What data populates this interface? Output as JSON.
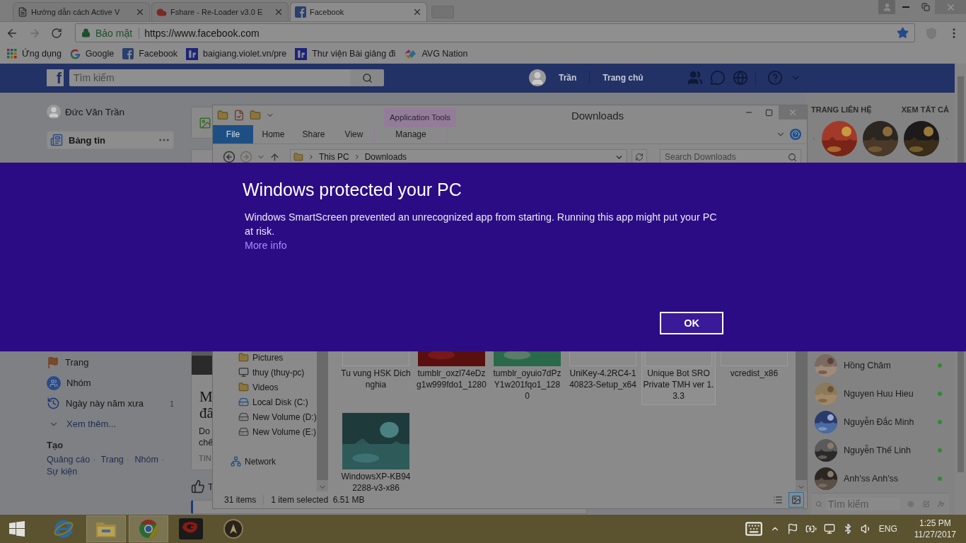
{
  "browser": {
    "tabs": [
      {
        "title": "Hướng dẫn cách Active V",
        "selected": false
      },
      {
        "title": "Fshare - Re-Loader v3.0 E",
        "selected": false
      },
      {
        "title": "Facebook",
        "selected": true
      }
    ],
    "address": {
      "security": "Bảo mật",
      "url": "https://www.facebook.com",
      "bookmarked": true
    },
    "bookmarks": [
      {
        "label": "Ứng dụng"
      },
      {
        "label": "Google"
      },
      {
        "label": "Facebook"
      },
      {
        "label": "baigiang.violet.vn/pre"
      },
      {
        "label": "Thư viện Bài giảng đi"
      },
      {
        "label": "AVG Nation"
      }
    ]
  },
  "facebook": {
    "logo": "f",
    "search": {
      "placeholder": "Tìm kiếm"
    },
    "user": "Trần",
    "home": "Trang chủ",
    "profile": "Đức Văn Trần",
    "menu": [
      {
        "label": "Bảng tin",
        "selected": true
      }
    ],
    "lower_menu": [
      {
        "label": "Trang",
        "kind": "item"
      },
      {
        "label": "Nhóm",
        "kind": "item"
      },
      {
        "label": "Ngày này năm xưa",
        "kind": "item",
        "count": "1"
      },
      {
        "label": "Xem thêm...",
        "kind": "more"
      }
    ],
    "create": {
      "title": "Tạo",
      "separator": "·",
      "links": [
        "Quảng cáo",
        "Trang",
        "Nhóm",
        "Sự kiện"
      ]
    },
    "post": {
      "title": [
        "M",
        "đâ"
      ],
      "text": [
        "Do",
        "chế"
      ],
      "tag": "TIN",
      "action": "T"
    },
    "pages": {
      "title": "TRANG LIÊN HỆ",
      "see_all": "XEM TẤT CẢ"
    },
    "contacts": [
      {
        "name": "Hồng Châm",
        "online": true
      },
      {
        "name": "Nguyen Huu Hieu",
        "online": true
      },
      {
        "name": "Nguyễn Đắc Minh",
        "online": true
      },
      {
        "name": "Nguyễn Thế Linh",
        "online": true
      },
      {
        "name": "Anh'ss Anh'ss",
        "online": true
      }
    ],
    "chat_search": {
      "placeholder": "Tìm kiếm"
    }
  },
  "explorer": {
    "title": "Downloads",
    "context_tab": "Application Tools",
    "ribbon_tabs": [
      {
        "label": "File",
        "selected": true
      },
      {
        "label": "Home",
        "selected": false
      },
      {
        "label": "Share",
        "selected": false
      },
      {
        "label": "View",
        "selected": false
      },
      {
        "label": "Manage",
        "selected": false
      }
    ],
    "path": [
      "This PC",
      "Downloads"
    ],
    "search": {
      "placeholder": "Search Downloads"
    },
    "nav": [
      {
        "label": "Pictures"
      },
      {
        "label": "thuy (thuy-pc)"
      },
      {
        "label": "Videos"
      },
      {
        "label": "Local Disk (C:)"
      },
      {
        "label": "New Volume (D:)"
      },
      {
        "label": "New Volume (E:)"
      },
      {
        "label": "Network"
      }
    ],
    "files": [
      {
        "name": "Tu vung HSK Dich nghia",
        "kind": "blank",
        "selected": false
      },
      {
        "name": "tumblr_oxzl74eDzg1w999fdo1_1280",
        "kind": "picture",
        "selected": false
      },
      {
        "name": "tumblr_oyuio7dPzY1w201fqo1_1280",
        "kind": "picture",
        "selected": false
      },
      {
        "name": "UniKey-4.2RC4-140823-Setup_x64",
        "kind": "blank",
        "selected": false
      },
      {
        "name": "Unique Bot SRO Private  TMH ver 1.3.3",
        "kind": "blank",
        "selected": true
      },
      {
        "name": "vcredist_x86",
        "kind": "blank",
        "selected": false
      },
      {
        "name": "WindowsXP-KB942288-v3-x86",
        "kind": "picture",
        "selected": false
      }
    ],
    "status": {
      "count": "31 items",
      "selection": "1 item selected  6.51 MB"
    }
  },
  "dialog": {
    "title": "Windows protected your PC",
    "message": "Windows SmartScreen prevented an unrecognized app from starting. Running this app might put your PC at risk.",
    "link": "More info",
    "button": "OK"
  },
  "taskbar": {
    "apps": [
      {
        "active": false
      },
      {
        "active": true
      },
      {
        "active": true
      },
      {
        "active": false
      },
      {
        "active": false
      }
    ],
    "language": "ENG",
    "time": "1:25 PM",
    "date": "11/27/2017"
  }
}
